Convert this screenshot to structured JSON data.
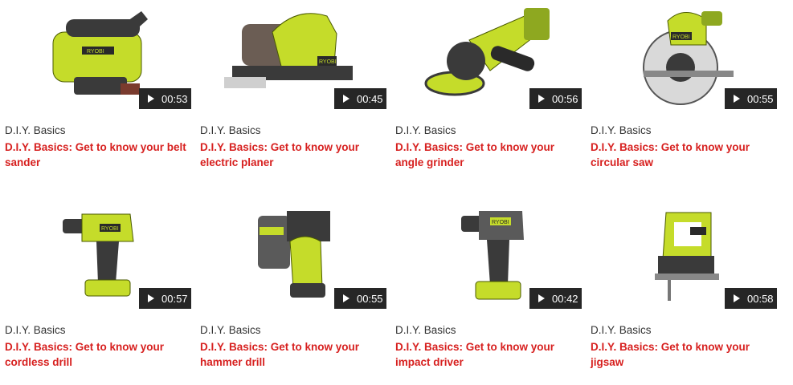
{
  "videos": [
    {
      "category": "D.I.Y. Basics",
      "title": "D.I.Y. Basics: Get to know your belt sander",
      "duration": "00:53",
      "icon": "belt-sander-icon"
    },
    {
      "category": "D.I.Y. Basics",
      "title": "D.I.Y. Basics: Get to know your electric planer",
      "duration": "00:45",
      "icon": "planer-icon"
    },
    {
      "category": "D.I.Y. Basics",
      "title": "D.I.Y. Basics: Get to know your angle grinder",
      "duration": "00:56",
      "icon": "angle-grinder-icon"
    },
    {
      "category": "D.I.Y. Basics",
      "title": "D.I.Y. Basics: Get to know your circular saw",
      "duration": "00:55",
      "icon": "circular-saw-icon"
    },
    {
      "category": "D.I.Y. Basics",
      "title": "D.I.Y. Basics: Get to know your cordless drill",
      "duration": "00:57",
      "icon": "cordless-drill-icon"
    },
    {
      "category": "D.I.Y. Basics",
      "title": "D.I.Y. Basics: Get to know your hammer drill",
      "duration": "00:55",
      "icon": "hammer-drill-icon"
    },
    {
      "category": "D.I.Y. Basics",
      "title": "D.I.Y. Basics: Get to know your impact driver",
      "duration": "00:42",
      "icon": "impact-driver-icon"
    },
    {
      "category": "D.I.Y. Basics",
      "title": "D.I.Y. Basics: Get to know your jigsaw",
      "duration": "00:58",
      "icon": "jigsaw-icon"
    }
  ],
  "brand_text": "RYOBI",
  "colors": {
    "title": "#d7201f",
    "tool_green": "#c5dc2a",
    "tool_dark": "#3a3a3a",
    "badge": "#262626"
  }
}
